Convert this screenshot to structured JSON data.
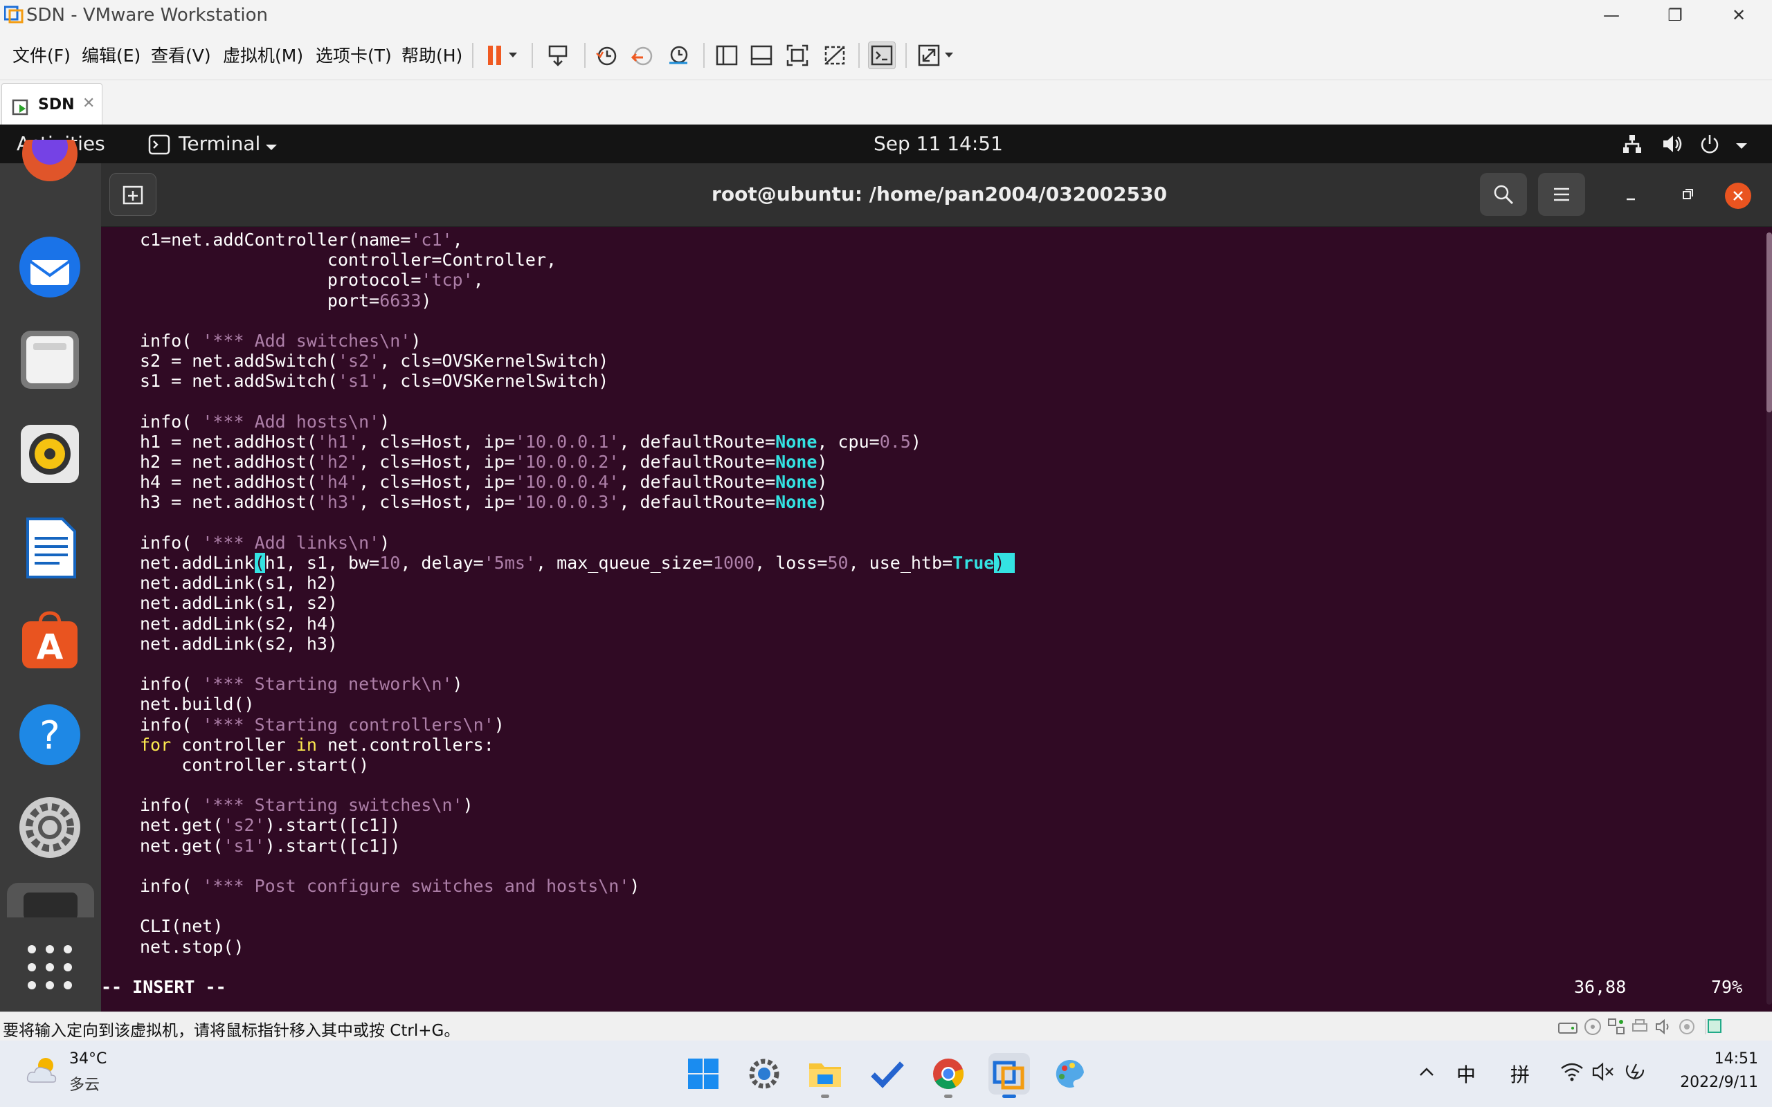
{
  "window": {
    "title": "SDN - VMware Workstation"
  },
  "menus": [
    "文件(F)",
    "编辑(E)",
    "查看(V)",
    "虚拟机(M)",
    "选项卡(T)",
    "帮助(H)"
  ],
  "tab": {
    "label": "SDN"
  },
  "ubuntu_bar": {
    "activities": "Activities",
    "app": "Terminal",
    "clock": "Sep 11  14:51"
  },
  "terminal": {
    "title": "root@ubuntu: /home/pan2004/032002530",
    "mode": "-- INSERT --",
    "position": "36,88",
    "percent": "79%",
    "code_lines": [
      [
        {
          "t": "c1=net.addController(name="
        },
        {
          "t": "'c1'",
          "c": "str"
        },
        {
          "t": ","
        }
      ],
      [
        {
          "t": "                  controller=Controller,"
        }
      ],
      [
        {
          "t": "                  protocol="
        },
        {
          "t": "'tcp'",
          "c": "str"
        },
        {
          "t": ","
        }
      ],
      [
        {
          "t": "                  port="
        },
        {
          "t": "6633",
          "c": "num"
        },
        {
          "t": ")"
        }
      ],
      [
        {
          "t": ""
        }
      ],
      [
        {
          "t": "info( "
        },
        {
          "t": "'*** Add switches\\n'",
          "c": "str"
        },
        {
          "t": ")"
        }
      ],
      [
        {
          "t": "s2 = net.addSwitch("
        },
        {
          "t": "'s2'",
          "c": "str"
        },
        {
          "t": ", cls=OVSKernelSwitch)"
        }
      ],
      [
        {
          "t": "s1 = net.addSwitch("
        },
        {
          "t": "'s1'",
          "c": "str"
        },
        {
          "t": ", cls=OVSKernelSwitch)"
        }
      ],
      [
        {
          "t": ""
        }
      ],
      [
        {
          "t": "info( "
        },
        {
          "t": "'*** Add hosts\\n'",
          "c": "str"
        },
        {
          "t": ")"
        }
      ],
      [
        {
          "t": "h1 = net.addHost("
        },
        {
          "t": "'h1'",
          "c": "str"
        },
        {
          "t": ", cls=Host, ip="
        },
        {
          "t": "'10.0.0.1'",
          "c": "str"
        },
        {
          "t": ", defaultRoute="
        },
        {
          "t": "None",
          "c": "bi"
        },
        {
          "t": ", cpu="
        },
        {
          "t": "0.5",
          "c": "num"
        },
        {
          "t": ")"
        }
      ],
      [
        {
          "t": "h2 = net.addHost("
        },
        {
          "t": "'h2'",
          "c": "str"
        },
        {
          "t": ", cls=Host, ip="
        },
        {
          "t": "'10.0.0.2'",
          "c": "str"
        },
        {
          "t": ", defaultRoute="
        },
        {
          "t": "None",
          "c": "bi"
        },
        {
          "t": ")"
        }
      ],
      [
        {
          "t": "h4 = net.addHost("
        },
        {
          "t": "'h4'",
          "c": "str"
        },
        {
          "t": ", cls=Host, ip="
        },
        {
          "t": "'10.0.0.4'",
          "c": "str"
        },
        {
          "t": ", defaultRoute="
        },
        {
          "t": "None",
          "c": "bi"
        },
        {
          "t": ")"
        }
      ],
      [
        {
          "t": "h3 = net.addHost("
        },
        {
          "t": "'h3'",
          "c": "str"
        },
        {
          "t": ", cls=Host, ip="
        },
        {
          "t": "'10.0.0.3'",
          "c": "str"
        },
        {
          "t": ", defaultRoute="
        },
        {
          "t": "None",
          "c": "bi"
        },
        {
          "t": ")"
        }
      ],
      [
        {
          "t": ""
        }
      ],
      [
        {
          "t": "info( "
        },
        {
          "t": "'*** Add links\\n'",
          "c": "str"
        },
        {
          "t": ")"
        }
      ],
      [
        {
          "t": "net.addLink"
        },
        {
          "t": "(",
          "c": "cur"
        },
        {
          "t": "h1, s1, bw="
        },
        {
          "t": "10",
          "c": "num"
        },
        {
          "t": ", delay="
        },
        {
          "t": "'5ms'",
          "c": "str"
        },
        {
          "t": ", max_queue_size="
        },
        {
          "t": "1000",
          "c": "num"
        },
        {
          "t": ", loss="
        },
        {
          "t": "50",
          "c": "num"
        },
        {
          "t": ", use_htb="
        },
        {
          "t": "True",
          "c": "bi"
        },
        {
          "t": ")",
          "c": "cur"
        },
        {
          "t": " ",
          "c": "cur"
        }
      ],
      [
        {
          "t": "net.addLink(s1, h2)"
        }
      ],
      [
        {
          "t": "net.addLink(s1, s2)"
        }
      ],
      [
        {
          "t": "net.addLink(s2, h4)"
        }
      ],
      [
        {
          "t": "net.addLink(s2, h3)"
        }
      ],
      [
        {
          "t": ""
        }
      ],
      [
        {
          "t": "info( "
        },
        {
          "t": "'*** Starting network\\n'",
          "c": "str"
        },
        {
          "t": ")"
        }
      ],
      [
        {
          "t": "net.build()"
        }
      ],
      [
        {
          "t": "info( "
        },
        {
          "t": "'*** Starting controllers\\n'",
          "c": "str"
        },
        {
          "t": ")"
        }
      ],
      [
        {
          "t": "for",
          "c": "kw"
        },
        {
          "t": " controller "
        },
        {
          "t": "in",
          "c": "kw"
        },
        {
          "t": " net.controllers:"
        }
      ],
      [
        {
          "t": "    controller.start()"
        }
      ],
      [
        {
          "t": ""
        }
      ],
      [
        {
          "t": "info( "
        },
        {
          "t": "'*** Starting switches\\n'",
          "c": "str"
        },
        {
          "t": ")"
        }
      ],
      [
        {
          "t": "net.get("
        },
        {
          "t": "'s2'",
          "c": "str"
        },
        {
          "t": ").start([c1])"
        }
      ],
      [
        {
          "t": "net.get("
        },
        {
          "t": "'s1'",
          "c": "str"
        },
        {
          "t": ").start([c1])"
        }
      ],
      [
        {
          "t": ""
        }
      ],
      [
        {
          "t": "info( "
        },
        {
          "t": "'*** Post configure switches and hosts\\n'",
          "c": "str"
        },
        {
          "t": ")"
        }
      ],
      [
        {
          "t": ""
        }
      ],
      [
        {
          "t": "CLI(net)"
        }
      ],
      [
        {
          "t": "net.stop()"
        }
      ]
    ]
  },
  "status": {
    "message": "要将输入定向到该虚拟机，请将鼠标指针移入其中或按 Ctrl+G。"
  },
  "taskbar": {
    "weather_temp": "34°C",
    "weather_desc": "多云",
    "ime1": "中",
    "ime2": "拼",
    "time": "14:51",
    "date": "2022/9/11"
  },
  "colors": {
    "terminal_bg": "#300a24",
    "string": "#ad7fa8",
    "builtin": "#34e2e2",
    "keyword": "#fce94f"
  }
}
